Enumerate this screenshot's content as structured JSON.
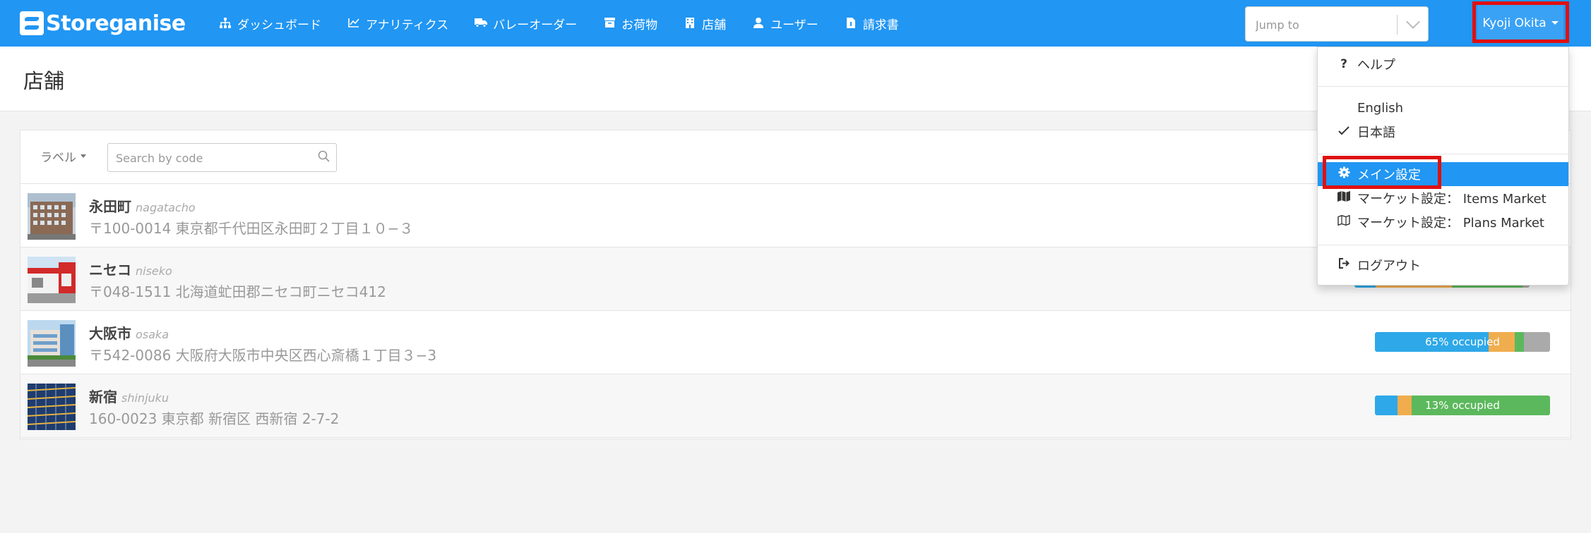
{
  "brand": {
    "name": "Storeganise"
  },
  "nav": {
    "items": [
      {
        "label": "ダッシュボード",
        "icon": "sitemap-icon"
      },
      {
        "label": "アナリティクス",
        "icon": "line-chart-icon"
      },
      {
        "label": "バレーオーダー",
        "icon": "truck-icon"
      },
      {
        "label": "お荷物",
        "icon": "archive-box-icon"
      },
      {
        "label": "店舗",
        "icon": "building-icon"
      },
      {
        "label": "ユーザー",
        "icon": "user-icon"
      },
      {
        "label": "請求書",
        "icon": "invoice-file-icon"
      }
    ],
    "jump_placeholder": "Jump to",
    "user_name": "Kyoji Okita"
  },
  "page": {
    "title": "店舗"
  },
  "toolbar": {
    "label_filter": "ラベル",
    "search_placeholder": "Search by code"
  },
  "stores": [
    {
      "name": "永田町",
      "code": "nagatacho",
      "address": "〒100-0014 東京都千代田区永田町２丁目１０−３",
      "occupancy": null
    },
    {
      "name": "ニセコ",
      "code": "niseko",
      "address": "〒048-1511 北海道虻田郡ニセコ町ニセコ412",
      "occupancy": null
    },
    {
      "name": "大阪市",
      "code": "osaka",
      "address": "〒542-0086 大阪府大阪市中央区西心斎橋１丁目３−3",
      "occupancy": {
        "label": "65% occupied",
        "segments": [
          {
            "color": "#2ea8e8",
            "fraction": 0.65
          },
          {
            "color": "#f0ad4e",
            "fraction": 0.15
          },
          {
            "color": "#5cb85c",
            "fraction": 0.05
          },
          {
            "color": "#aaaaaa",
            "fraction": 0.15
          }
        ]
      }
    },
    {
      "name": "新宿",
      "code": "shinjuku",
      "address": "160-0023 東京都 新宿区 西新宿 2-7-2",
      "occupancy": {
        "label": "13% occupied",
        "segments": [
          {
            "color": "#2ea8e8",
            "fraction": 0.13
          },
          {
            "color": "#f0ad4e",
            "fraction": 0.08
          },
          {
            "color": "#5cb85c",
            "fraction": 0.79
          }
        ]
      }
    }
  ],
  "dropdown": {
    "help": "ヘルプ",
    "lang_en": "English",
    "lang_ja": "日本語",
    "main_settings": "メイン設定",
    "market_items": "マーケット設定： Items Market",
    "market_plans": "マーケット設定： Plans Market",
    "logout": "ログアウト"
  },
  "colors": {
    "primary": "#2196f3",
    "highlight": "#e01010"
  }
}
